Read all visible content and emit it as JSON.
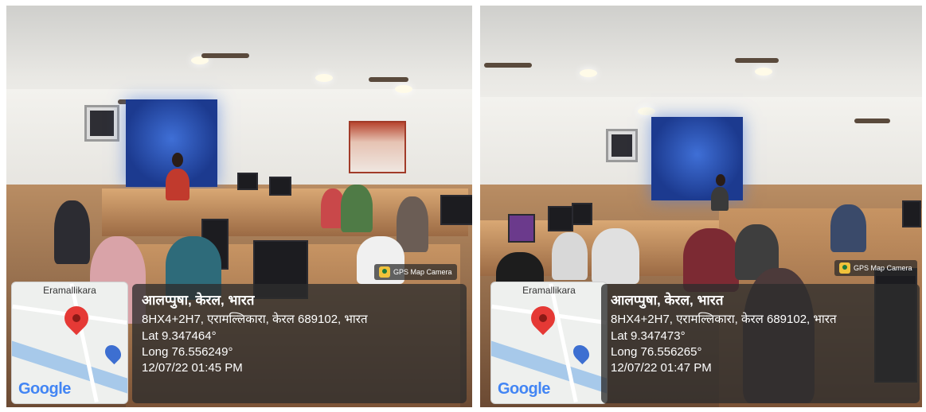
{
  "photos": [
    {
      "gps_badge": "GPS Map Camera",
      "map_label": "Eramallikara",
      "map_logo": "Google",
      "title": "आलप्पुषा, केरल, भारत",
      "address": "8HX4+2H7, एरामल्लिकारा, केरल 689102, भारत",
      "lat": "Lat 9.347464°",
      "long": "Long 76.556249°",
      "datetime": "12/07/22 01:45 PM"
    },
    {
      "gps_badge": "GPS Map Camera",
      "map_label": "Eramallikara",
      "map_logo": "Google",
      "title": "आलप्पुषा, केरल, भारत",
      "address": "8HX4+2H7, एरामल्लिकारा, केरल 689102, भारत",
      "lat": "Lat 9.347473°",
      "long": "Long 76.556265°",
      "datetime": "12/07/22 01:47 PM"
    }
  ],
  "colors": {
    "overlay": "#2d2d2d",
    "pin": "#e53935",
    "projector_screen": "#2b56c2",
    "desk_wood": "#c08a5a"
  },
  "icons": [
    "gps-map-camera-icon",
    "location-pin-icon",
    "fuel-station-icon"
  ]
}
